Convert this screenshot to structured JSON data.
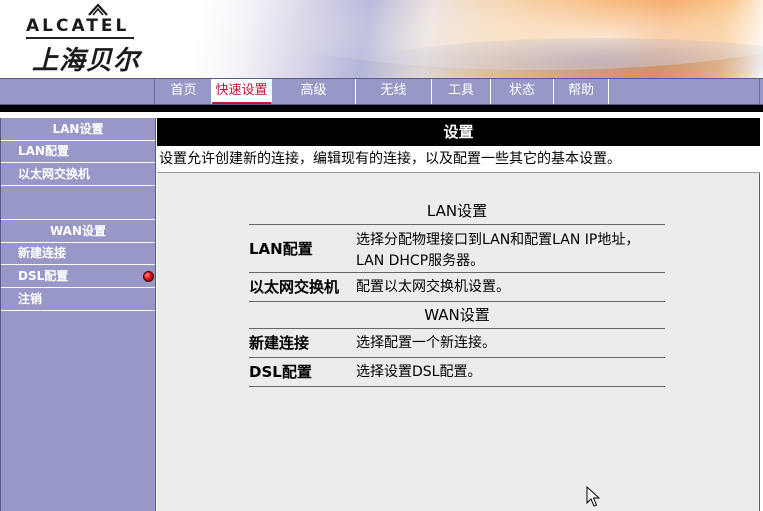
{
  "brand": {
    "wordmark": "ALCATEL",
    "chinese_name": "上海贝尔"
  },
  "nav": {
    "tabs": [
      {
        "label": "首页"
      },
      {
        "label": "快速设置"
      },
      {
        "label": "高级"
      },
      {
        "label": "无线"
      },
      {
        "label": "工具"
      },
      {
        "label": "状态"
      },
      {
        "label": "帮助"
      }
    ],
    "active_tab": "快速设置"
  },
  "sidebar": {
    "lan_heading": "LAN设置",
    "lan_items": [
      {
        "label": "LAN配置"
      },
      {
        "label": "以太网交换机"
      }
    ],
    "wan_heading": "WAN设置",
    "wan_items": [
      {
        "label": "新建连接"
      },
      {
        "label": "DSL配置"
      },
      {
        "label": "注销"
      }
    ]
  },
  "main": {
    "title": "设置",
    "description": "设置允许创建新的连接，编辑现有的连接，以及配置一些其它的基本设置。",
    "lan_section": {
      "heading": "LAN设置",
      "rows": [
        {
          "label": "LAN配置",
          "desc": "选择分配物理接口到LAN和配置LAN IP地址，LAN DHCP服务器。"
        },
        {
          "label": "以太网交换机",
          "desc": "配置以太网交换机设置。"
        }
      ]
    },
    "wan_section": {
      "heading": "WAN设置",
      "rows": [
        {
          "label": "新建连接",
          "desc": "选择配置一个新连接。"
        },
        {
          "label": "DSL配置",
          "desc": "选择设置DSL配置。"
        }
      ]
    }
  },
  "colors": {
    "nav_bg": "#9798c8",
    "active_tab_text": "#c4143c",
    "title_bar_bg": "#000000",
    "content_bg": "#ececea",
    "status_dot": "#e01010"
  }
}
